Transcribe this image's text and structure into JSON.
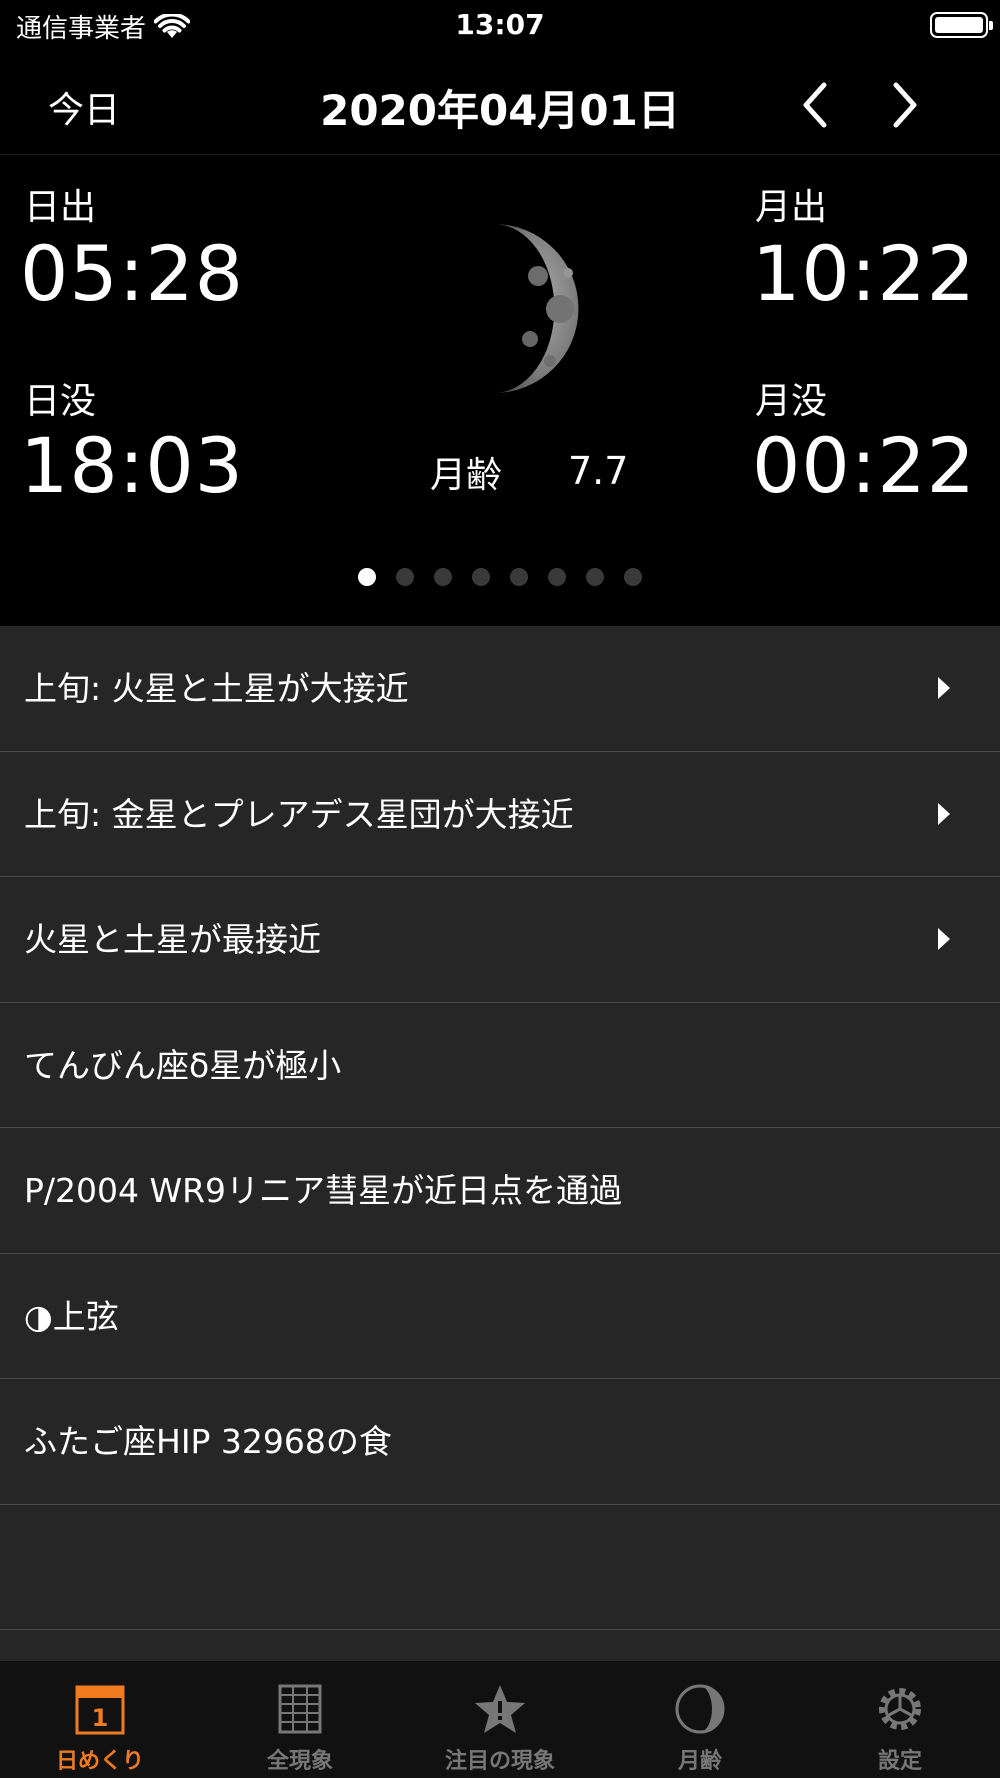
{
  "status_bar": {
    "carrier": "通信事業者",
    "time": "13:07"
  },
  "nav": {
    "today_label": "今日",
    "title": "2020年04月01日"
  },
  "sun": {
    "rise_label": "日出",
    "rise_time": "05:28",
    "set_label": "日没",
    "set_time": "18:03"
  },
  "moon": {
    "rise_label": "月出",
    "rise_time": "10:22",
    "set_label": "月没",
    "set_time": "00:22",
    "age_label": "月齢",
    "age_value": "7.7"
  },
  "pager": {
    "page_count": 8,
    "current_page": 1
  },
  "events": [
    {
      "label": "上旬: 火星と土星が大接近",
      "has_detail": true
    },
    {
      "label": "上旬: 金星とプレアデス星団が大接近",
      "has_detail": true
    },
    {
      "label": "火星と土星が最接近",
      "has_detail": true
    },
    {
      "label": "てんびん座δ星が極小",
      "has_detail": false
    },
    {
      "label": "P/2004 WR9リニア彗星が近日点を通過",
      "has_detail": false
    },
    {
      "label": "◑上弦",
      "has_detail": false
    },
    {
      "label": "ふたご座HIP 32968の食",
      "has_detail": false
    },
    {
      "label": "",
      "has_detail": false
    }
  ],
  "tabs": [
    {
      "label": "日めくり",
      "icon": "calendar-icon",
      "active": true
    },
    {
      "label": "全現象",
      "icon": "list-grid-icon",
      "active": false
    },
    {
      "label": "注目の現象",
      "icon": "star-icon",
      "active": false
    },
    {
      "label": "月齢",
      "icon": "moon-phase-icon",
      "active": false
    },
    {
      "label": "設定",
      "icon": "gear-icon",
      "active": false
    }
  ],
  "colors": {
    "accent": "#f07a1e",
    "inactive_tab": "#777777",
    "list_bg": "#262626",
    "background": "#000000"
  }
}
